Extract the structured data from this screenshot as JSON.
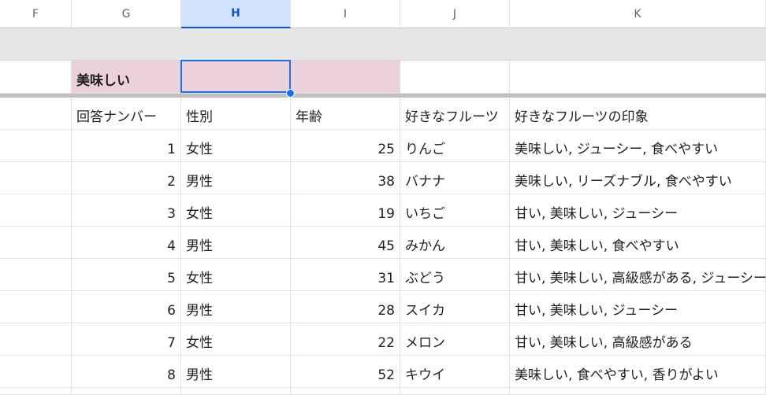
{
  "columns": [
    "F",
    "G",
    "H",
    "I",
    "J",
    "K"
  ],
  "selected_column": "H",
  "category_label": "美味しい",
  "headers": [
    "回答ナンバー",
    "性別",
    "年齢",
    "好きなフルーツ",
    "好きなフルーツの印象"
  ],
  "rows": [
    {
      "no": "1",
      "gender": "女性",
      "age": "25",
      "fruit": "りんご",
      "impression": "美味しい, ジューシー, 食べやすい"
    },
    {
      "no": "2",
      "gender": "男性",
      "age": "38",
      "fruit": "バナナ",
      "impression": "美味しい, リーズナブル, 食べやすい"
    },
    {
      "no": "3",
      "gender": "女性",
      "age": "19",
      "fruit": "いちご",
      "impression": "甘い, 美味しい, ジューシー"
    },
    {
      "no": "4",
      "gender": "男性",
      "age": "45",
      "fruit": "みかん",
      "impression": "甘い, 美味しい, 食べやすい"
    },
    {
      "no": "5",
      "gender": "女性",
      "age": "31",
      "fruit": "ぶどう",
      "impression": "甘い, 美味しい, 高級感がある, ジューシー"
    },
    {
      "no": "6",
      "gender": "男性",
      "age": "28",
      "fruit": "スイカ",
      "impression": "甘い, 美味しい, ジューシー"
    },
    {
      "no": "7",
      "gender": "女性",
      "age": "22",
      "fruit": "メロン",
      "impression": "甘い, 美味しい, 高級感がある"
    },
    {
      "no": "8",
      "gender": "男性",
      "age": "52",
      "fruit": "キウイ",
      "impression": "美味しい, 食べやすい, 香りがよい"
    }
  ],
  "colors": {
    "selection": "#1a73e8",
    "selected_header_bg": "#d3e3fd",
    "highlight_fill": "#ead1dc",
    "frozen_gray": "#e6e6e6"
  }
}
